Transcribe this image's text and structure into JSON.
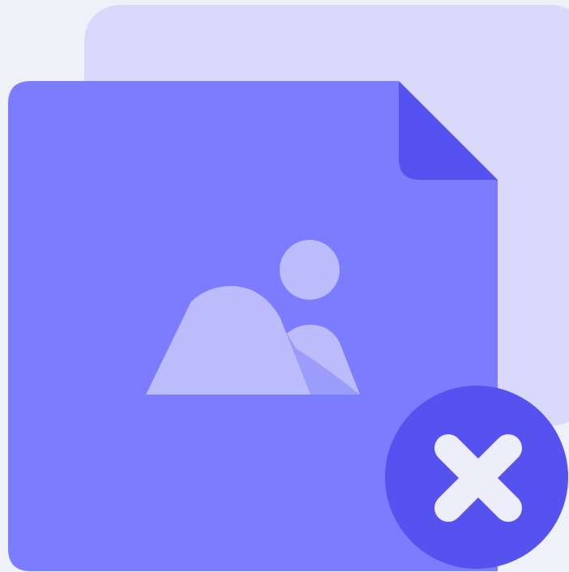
{
  "illustration": {
    "subject": "image-file-remove",
    "icons": {
      "back_file": "file-icon",
      "front_file": "image-file-icon",
      "picture": "picture-icon",
      "remove": "close-icon"
    },
    "colors": {
      "background": "#eff1f9",
      "back_sheet": "#d9d9fb",
      "front_sheet": "#7b7cfe",
      "folded_corner": "#5552f0",
      "picture_light": "#bcbcfc",
      "picture_shadow": "#9c9cfa",
      "remove_badge": "#5552f0",
      "remove_cross": "#eeeefb"
    }
  }
}
